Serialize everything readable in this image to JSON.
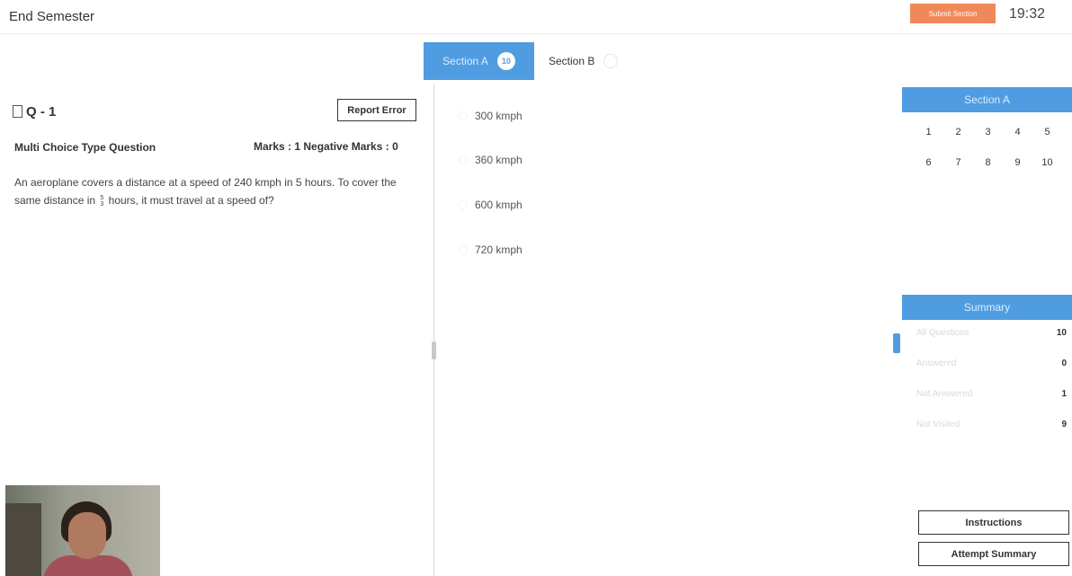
{
  "header": {
    "title": "End Semester",
    "submit_label": "Submit Section",
    "timer": "19:32"
  },
  "tabs": [
    {
      "label": "Section A",
      "count": "10"
    },
    {
      "label": "Section B",
      "count": ""
    }
  ],
  "question": {
    "number": "Q - 1",
    "report_label": "Report Error",
    "type": "Multi Choice Type Question",
    "marks": "Marks : 1  Negative Marks : 0",
    "text_part1": "An aeroplane covers a distance at a speed of 240 kmph in 5 hours. To cover the same distance in",
    "fraction_num": "5",
    "fraction_den": "3",
    "text_part2": "hours, it must travel at a speed of?"
  },
  "options": [
    "300 kmph",
    "360 kmph",
    "600 kmph",
    "720 kmph"
  ],
  "sidebar": {
    "section_title": "Section A",
    "question_numbers": [
      "1",
      "2",
      "3",
      "4",
      "5",
      "6",
      "7",
      "8",
      "9",
      "10"
    ],
    "summary_title": "Summary",
    "summary_rows": [
      {
        "label": "All Questions",
        "value": "10"
      },
      {
        "label": "Answered",
        "value": "0"
      },
      {
        "label": "Not Answered",
        "value": "1"
      },
      {
        "label": "Not Visited",
        "value": "9"
      }
    ],
    "instructions_label": "Instructions",
    "attempt_summary_label": "Attempt Summary"
  },
  "colors": {
    "accent": "#4f9de0",
    "submit": "#f0895a"
  }
}
